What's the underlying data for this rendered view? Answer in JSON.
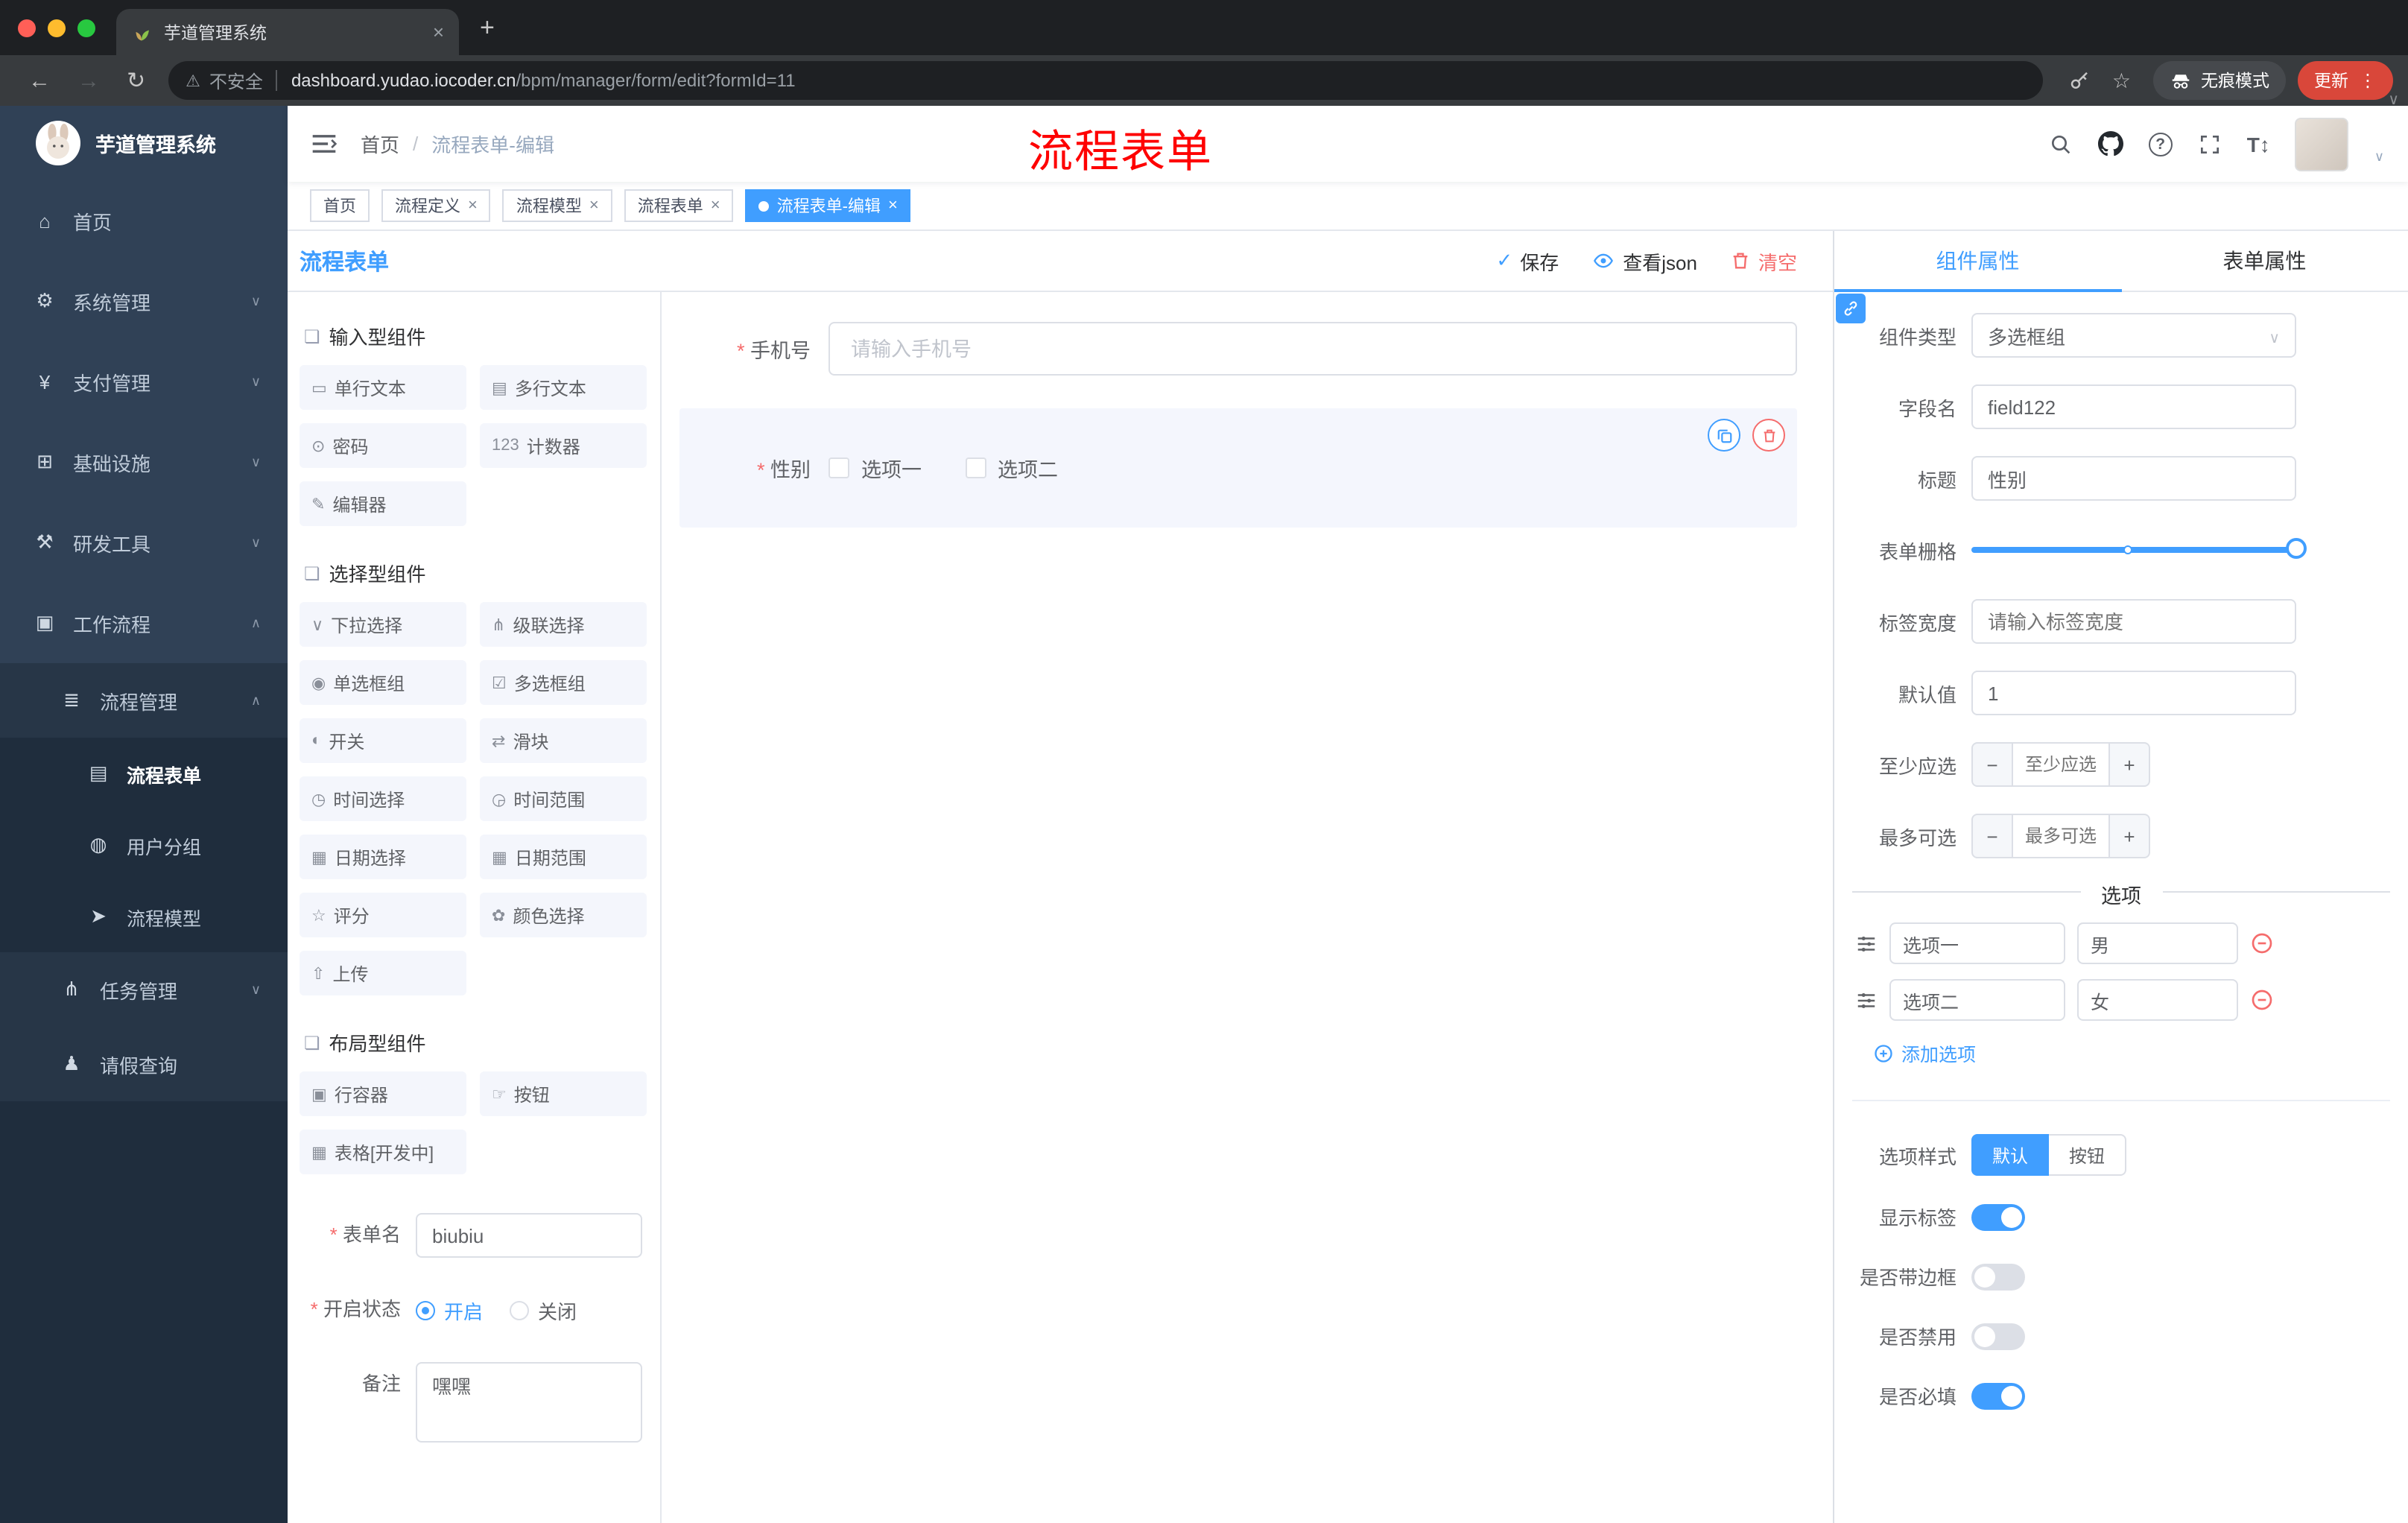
{
  "colors": {
    "accent": "#409eff",
    "danger": "#f56c6c",
    "sidebar_bg": "#304156",
    "annotation_red": "#fe0000"
  },
  "browser": {
    "tab_title": "芋道管理系统",
    "security_text": "不安全",
    "url_host": "dashboard.yudao.iocoder.cn",
    "url_path": "/bpm/manager/form/edit?formId=11",
    "incognito_label": "无痕模式",
    "update_label": "更新",
    "menu_dots": "⋮"
  },
  "sidebar": {
    "app_title": "芋道管理系统",
    "items": [
      {
        "icon": "⌂",
        "label": "首页",
        "chevron": ""
      },
      {
        "icon": "⚙",
        "label": "系统管理",
        "chevron": "∨"
      },
      {
        "icon": "¥",
        "label": "支付管理",
        "chevron": "∨"
      },
      {
        "icon": "⊞",
        "label": "基础设施",
        "chevron": "∨"
      },
      {
        "icon": "⚒",
        "label": "研发工具",
        "chevron": "∨"
      },
      {
        "icon": "▣",
        "label": "工作流程",
        "chevron": "∧"
      },
      {
        "icon": "≣",
        "label": "流程管理",
        "chevron": "∧"
      },
      {
        "icon": "▤",
        "label": "流程表单",
        "chevron": ""
      },
      {
        "icon": "◍",
        "label": "用户分组",
        "chevron": ""
      },
      {
        "icon": "➤",
        "label": "流程模型",
        "chevron": ""
      },
      {
        "icon": "⋔",
        "label": "任务管理",
        "chevron": "∨"
      },
      {
        "icon": "♟",
        "label": "请假查询",
        "chevron": ""
      }
    ]
  },
  "header": {
    "breadcrumb_home": "首页",
    "breadcrumb_current": "流程表单-编辑",
    "annotation": "流程表单"
  },
  "tags": [
    {
      "label": "首页"
    },
    {
      "label": "流程定义"
    },
    {
      "label": "流程模型"
    },
    {
      "label": "流程表单"
    },
    {
      "label": "流程表单-编辑"
    }
  ],
  "designer": {
    "title": "流程表单",
    "save_label": "保存",
    "view_json_label": "查看json",
    "clear_label": "清空",
    "palette": {
      "sections": [
        {
          "title": "输入型组件",
          "items": [
            {
              "icon": "▭",
              "label": "单行文本"
            },
            {
              "icon": "▤",
              "label": "多行文本"
            },
            {
              "icon": "⊙",
              "label": "密码"
            },
            {
              "icon": "123",
              "label": "计数器"
            },
            {
              "icon": "✎",
              "label": "编辑器"
            }
          ]
        },
        {
          "title": "选择型组件",
          "items": [
            {
              "icon": "∨",
              "label": "下拉选择"
            },
            {
              "icon": "⋔",
              "label": "级联选择"
            },
            {
              "icon": "◉",
              "label": "单选框组"
            },
            {
              "icon": "☑",
              "label": "多选框组"
            },
            {
              "icon": "◐",
              "label": "开关"
            },
            {
              "icon": "⇄",
              "label": "滑块"
            },
            {
              "icon": "◷",
              "label": "时间选择"
            },
            {
              "icon": "◶",
              "label": "时间范围"
            },
            {
              "icon": "▦",
              "label": "日期选择"
            },
            {
              "icon": "▦",
              "label": "日期范围"
            },
            {
              "icon": "☆",
              "label": "评分"
            },
            {
              "icon": "✿",
              "label": "颜色选择"
            },
            {
              "icon": "⇧",
              "label": "上传"
            }
          ]
        },
        {
          "title": "布局型组件",
          "items": [
            {
              "icon": "▣",
              "label": "行容器"
            },
            {
              "icon": "☞",
              "label": "按钮"
            },
            {
              "icon": "▦",
              "label": "表格[开发中]"
            }
          ]
        }
      ]
    },
    "meta": {
      "form_name_label": "表单名",
      "form_name_value": "biubiu",
      "status_label": "开启状态",
      "status_on": "开启",
      "status_off": "关闭",
      "remark_label": "备注",
      "remark_value": "嘿嘿"
    },
    "canvas": {
      "phone_label": "手机号",
      "phone_placeholder": "请输入手机号",
      "gender_label": "性别",
      "gender_option1": "选项一",
      "gender_option2": "选项二"
    }
  },
  "properties": {
    "tab_component": "组件属性",
    "tab_form": "表单属性",
    "type_label": "组件类型",
    "type_value": "多选框组",
    "field_label": "字段名",
    "field_value": "field122",
    "title_label": "标题",
    "title_value": "性别",
    "grid_label": "表单栅格",
    "width_label": "标签宽度",
    "width_placeholder": "请输入标签宽度",
    "default_label": "默认值",
    "default_value": "1",
    "min_label": "至少应选",
    "min_placeholder": "至少应选",
    "max_label": "最多可选",
    "max_placeholder": "最多可选",
    "options_title": "选项",
    "options": [
      {
        "label": "选项一",
        "value": "男"
      },
      {
        "label": "选项二",
        "value": "女"
      }
    ],
    "add_option_label": "添加选项",
    "style_label": "选项样式",
    "style_default": "默认",
    "style_button": "按钮",
    "toggle_show_label": "显示标签",
    "toggle_border_label": "是否带边框",
    "toggle_disabled_label": "是否禁用",
    "toggle_required_label": "是否必填"
  }
}
